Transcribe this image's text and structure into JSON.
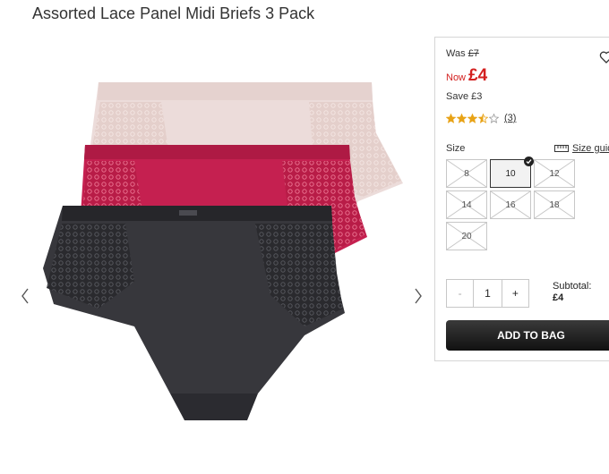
{
  "product": {
    "title": "Assorted Lace Panel Midi Briefs 3 Pack"
  },
  "pricing": {
    "was_label": "Was",
    "was_price": "£7",
    "now_label": "Now",
    "now_price": "£4",
    "save_text": "Save £3",
    "now_color": "#d3201f"
  },
  "rating": {
    "stars": 3.5,
    "max": 5,
    "count": "(3)",
    "star_color": "#e8a317"
  },
  "size": {
    "label": "Size",
    "guide_label": "Size guide",
    "options": [
      {
        "label": "8",
        "available": false,
        "selected": false
      },
      {
        "label": "10",
        "available": true,
        "selected": true
      },
      {
        "label": "12",
        "available": false,
        "selected": false
      },
      {
        "label": "14",
        "available": false,
        "selected": false
      },
      {
        "label": "16",
        "available": false,
        "selected": false
      },
      {
        "label": "18",
        "available": false,
        "selected": false
      },
      {
        "label": "20",
        "available": false,
        "selected": false
      }
    ]
  },
  "quantity": {
    "minus": "-",
    "value": "1",
    "plus": "+"
  },
  "subtotal": {
    "label": "Subtotal:",
    "amount": "£4"
  },
  "actions": {
    "add_to_bag": "ADD TO BAG"
  },
  "gallery": {
    "prev_icon": "chevron-left-icon",
    "next_icon": "chevron-right-icon"
  },
  "icons": {
    "wishlist": "heart-icon",
    "size_guide": "ruler-icon"
  }
}
